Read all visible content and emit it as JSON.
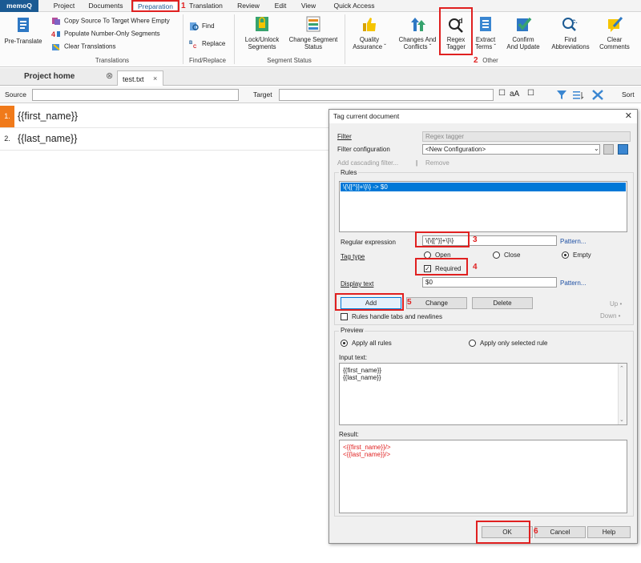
{
  "menu": {
    "tabs": [
      "memoQ",
      "Project",
      "Documents",
      "Preparation",
      "Translation",
      "Review",
      "Edit",
      "View",
      "Quick Access"
    ],
    "active": "Preparation"
  },
  "ribbon": {
    "pretranslate": "Pre-Translate",
    "copy_source": "Copy Source To Target Where Empty",
    "populate_numbers": "Populate Number-Only Segments",
    "clear_translations": "Clear Translations",
    "group_translations": "Translations",
    "find": "Find",
    "replace": "Replace",
    "group_find_replace": "Find/Replace",
    "lock_unlock": [
      "Lock/Unlock",
      "Segments"
    ],
    "change_status": [
      "Change Segment",
      "Status"
    ],
    "group_segment_status": "Segment Status",
    "quality": [
      "Quality",
      "Assurance ˇ"
    ],
    "changes": [
      "Changes And",
      "Conflicts ˇ"
    ],
    "regex_tagger": [
      "Regex",
      "Tagger"
    ],
    "extract_terms": [
      "Extract",
      "Terms ˇ"
    ],
    "confirm_update": [
      "Confirm",
      "And Update"
    ],
    "find_abbreviations": [
      "Find",
      "Abbreviations"
    ],
    "clear_comments": [
      "Clear",
      "Comments"
    ],
    "group_other": "Other"
  },
  "doc_tabs": {
    "project_home": "Project home",
    "file": "test.txt"
  },
  "filterbar": {
    "source_label": "Source",
    "target_label": "Target",
    "aa_label": "aA",
    "sort_label": "Sort"
  },
  "segments": [
    {
      "num": "1.",
      "text": "{{first_name}}"
    },
    {
      "num": "2.",
      "text": "{{last_name}}"
    }
  ],
  "dialog": {
    "title": "Tag current document",
    "filter_label": "Filter",
    "filter_value": "Regex tagger",
    "config_label": "Filter configuration",
    "config_value": "<New Configuration>",
    "add_cascading": "Add cascading filter...",
    "remove": "Remove",
    "rules_label": "Rules",
    "rules": [
      "\\{\\{[^}]+\\}\\} -> $0"
    ],
    "regex_label": "Regular expression",
    "regex_value": "\\{\\{[^}]+\\}\\}",
    "pattern_link": "Pattern...",
    "tag_type_label": "Tag type",
    "tag_open": "Open",
    "tag_close": "Close",
    "tag_empty": "Empty",
    "tag_selected": "Empty",
    "required_label": "Required",
    "required_checked": true,
    "display_text_label": "Display text",
    "display_text_value": "$0",
    "pattern_link_2": "Pattern...",
    "add_button": "Add",
    "change_button": "Change",
    "delete_button": "Delete",
    "up_label": "Up •",
    "down_label": "Down •",
    "rules_tabs_label": "Rules handle tabs and newlines",
    "preview_label": "Preview",
    "apply_all": "Apply all rules",
    "apply_selected": "Apply only selected rule",
    "input_label": "Input text:",
    "input_lines": [
      "{{first_name}}",
      "{{last_name}}"
    ],
    "result_label": "Result:",
    "result_lines": [
      "<{{first_name}}/>",
      "<{{last_name}}/>"
    ],
    "ok_button": "OK",
    "cancel_button": "Cancel",
    "help_button": "Help"
  },
  "callouts": [
    "1",
    "2",
    "3",
    "4",
    "5",
    "6"
  ],
  "colors": {
    "brand_blue": "#1b5a93",
    "highlight_red": "#e02020",
    "segment_orange": "#f07a1a",
    "result_red": "#e02020",
    "selection_blue": "#0078d7"
  }
}
